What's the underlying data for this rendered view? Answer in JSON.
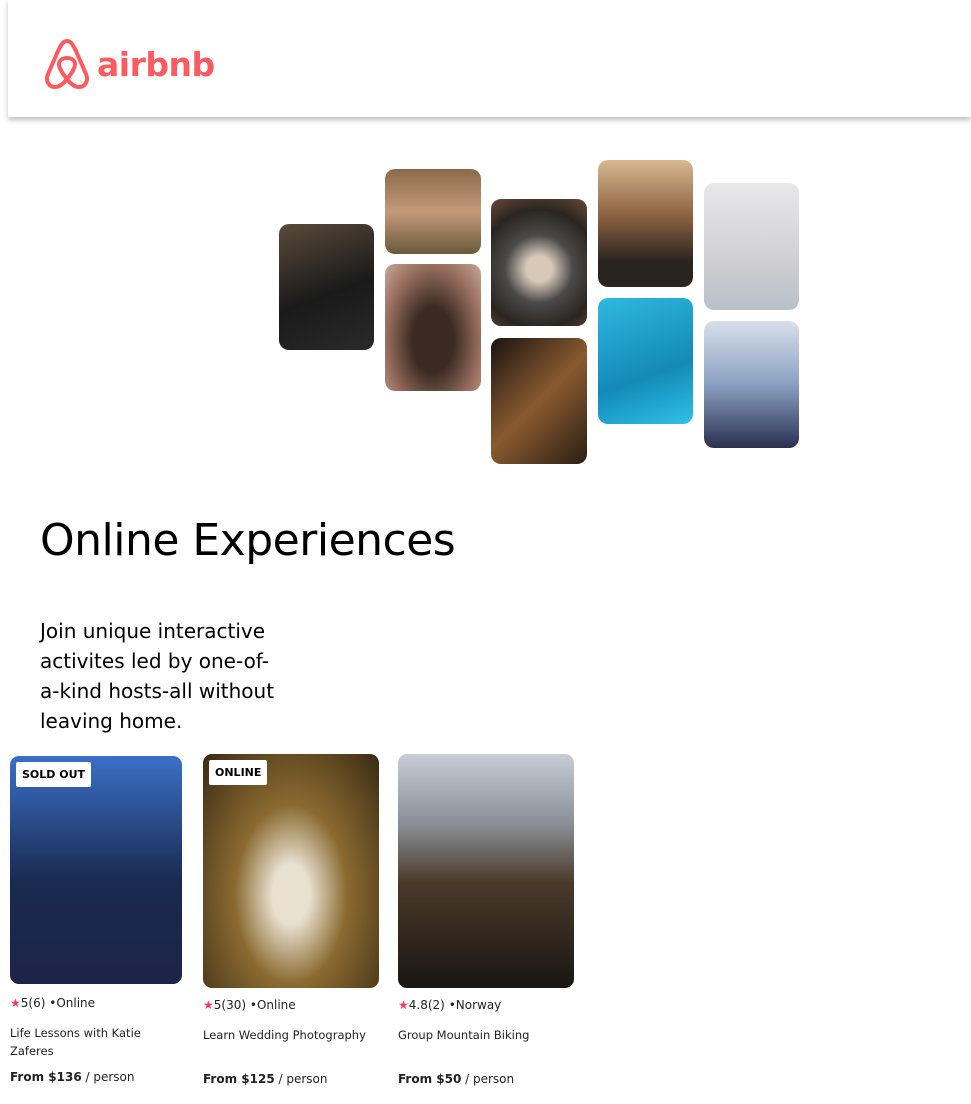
{
  "header": {
    "logo_text": "airbnb",
    "brand_color": "#ff5a5f"
  },
  "hero": {
    "photos": [
      "cooking",
      "portrait-host",
      "dancer-doorway",
      "food-bowl",
      "guitar",
      "piano-microphone",
      "swimmer",
      "yoga",
      "singer"
    ]
  },
  "main": {
    "title": "Online Experiences",
    "intro": "Join unique interactive activites led by one-of-a-kind hosts-all without leaving home."
  },
  "cards": [
    {
      "badge": "SOLD OUT",
      "rating": "5",
      "reviews": "(6)",
      "location": "•Online",
      "title": "Life Lessons with Katie Zaferes",
      "price": "From $136",
      "unit": " / person"
    },
    {
      "badge": "ONLINE",
      "rating": "5",
      "reviews": "(30)",
      "location": "•Online",
      "title": "Learn Wedding Photography",
      "price": "From $125",
      "unit": " / person"
    },
    {
      "badge": null,
      "rating": "4.8",
      "reviews": "(2)",
      "location": "•Norway",
      "title": "Group Mountain Biking",
      "price": "From $50",
      "unit": " / person"
    }
  ],
  "star_icon": "★"
}
